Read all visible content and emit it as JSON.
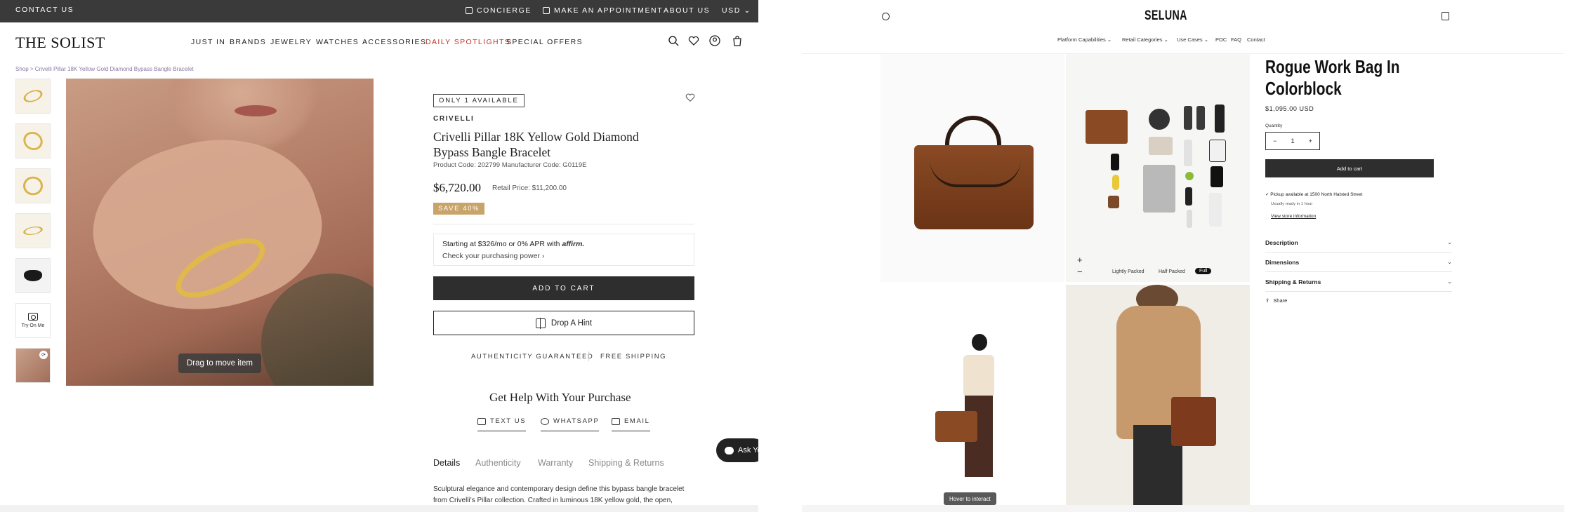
{
  "left": {
    "topbar": {
      "contact": "CONTACT US",
      "concierge": "CONCIERGE",
      "appointment": "MAKE AN APPOINTMENT",
      "about": "ABOUT US",
      "currency": "USD ⌄"
    },
    "brand": "THE SOLIST",
    "nav": [
      "JUST IN",
      "BRANDS",
      "JEWELRY",
      "WATCHES",
      "ACCESSORIES",
      "DAILY SPOTLIGHTS",
      "SPECIAL OFFERS"
    ],
    "breadcrumb": "Shop > Crivelli Pillar 18K Yellow Gold Diamond Bypass Bangle Bracelet",
    "try_on": "Try On Me",
    "drag_hint": "Drag to move item",
    "product": {
      "availability": "ONLY 1 AVAILABLE",
      "brand": "CRIVELLI",
      "title": "Crivelli Pillar 18K Yellow Gold Diamond Bypass Bangle Bracelet",
      "codes": "Product Code: 202799   Manufacturer Code: G0119E",
      "price": "$6,720.00",
      "retail": "Retail Price: $11,200.00",
      "save": "SAVE 40%",
      "affirm_line": "Starting at $326/mo or 0% APR with",
      "affirm_brand": "affirm.",
      "affirm_sub": "Check your purchasing power ›",
      "add_to_cart": "ADD TO CART",
      "drop_hint": "Drop A Hint",
      "authenticity": "AUTHENTICITY GUARANTEED",
      "shipping": "FREE SHIPPING"
    },
    "help": {
      "title": "Get Help With Your Purchase",
      "text": "TEXT US",
      "whatsapp": "WHATSAPP",
      "email": "EMAIL"
    },
    "tabs": [
      "Details",
      "Authenticity",
      "Warranty",
      "Shipping & Returns"
    ],
    "description": "Sculptural elegance and contemporary design define this bypass bangle bracelet from Crivelli's Pillar collection. Crafted in luminous 18K yellow gold, the open,",
    "chat": "Ask Yo"
  },
  "right": {
    "brand": "SELUNA",
    "nav": [
      "Platform Capabilities ⌄",
      "Retail Categories ⌄",
      "Use Cases ⌄",
      "POC",
      "FAQ",
      "Contact"
    ],
    "pack_options": [
      "Lightly Packed",
      "Half Packed",
      "Full"
    ],
    "zoom_in": "+",
    "zoom_out": "−",
    "hover_hint": "Hover to interact",
    "product": {
      "title": "Rogue Work Bag In Colorblock",
      "price": "$1,095.00 USD",
      "qty_label": "Quantity",
      "qty_minus": "−",
      "qty_value": "1",
      "qty_plus": "+",
      "add_to_cart": "Add to cart",
      "pickup": "✓ Pickup available at 1500 North Halsted Street",
      "ready": "Usually ready in 1 hour",
      "store_info": "View store information",
      "accordions": [
        "Description",
        "Dimensions",
        "Shipping & Returns"
      ],
      "share": "Share"
    }
  }
}
